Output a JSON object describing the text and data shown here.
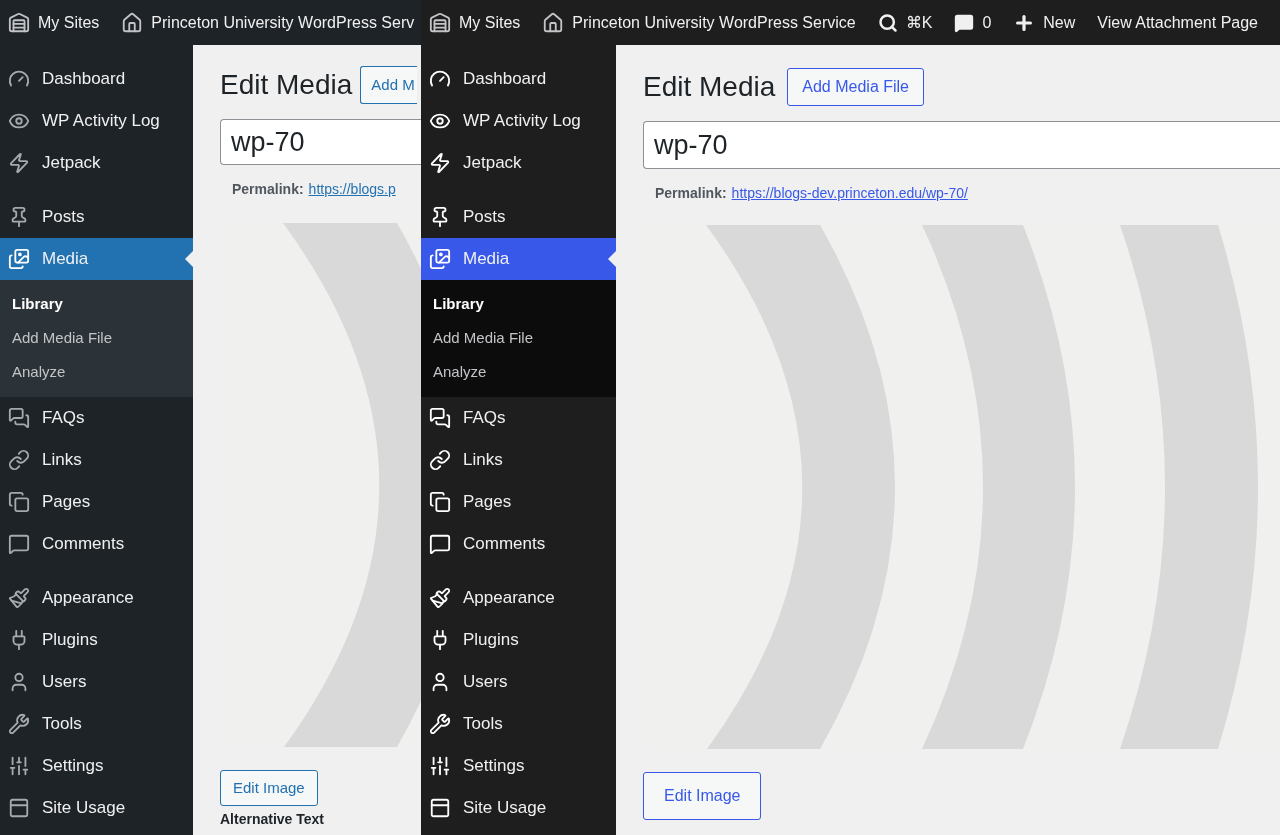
{
  "panels": [
    {
      "kind": "default",
      "admin_bar": [
        {
          "kind": "my-sites",
          "label": "My Sites"
        },
        {
          "kind": "site",
          "label": "Princeton University WordPress Serv"
        }
      ],
      "menu": [
        {
          "items": [
            {
              "label": "Dashboard",
              "selected": false
            },
            {
              "label": "WP Activity Log",
              "selected": false
            },
            {
              "label": "Jetpack",
              "selected": false
            }
          ]
        },
        {
          "items": [
            {
              "label": "Posts",
              "selected": false
            },
            {
              "label": "Media",
              "selected": true,
              "children": [
                {
                  "label": "Library",
                  "selected": true
                },
                {
                  "label": "Add Media File",
                  "selected": false
                },
                {
                  "label": "Analyze",
                  "selected": false
                }
              ]
            },
            {
              "label": "FAQs",
              "selected": false
            },
            {
              "label": "Links",
              "selected": false
            },
            {
              "label": "Pages",
              "selected": false
            },
            {
              "label": "Comments",
              "selected": false
            }
          ]
        },
        {
          "items": [
            {
              "label": "Appearance",
              "selected": false
            },
            {
              "label": "Plugins",
              "selected": false
            },
            {
              "label": "Users",
              "selected": false
            },
            {
              "label": "Tools",
              "selected": false
            },
            {
              "label": "Settings",
              "selected": false
            },
            {
              "label": "Site Usage",
              "selected": false
            }
          ]
        }
      ],
      "title": "Edit Media",
      "add_button": "Add M",
      "title_value": "wp-70",
      "permalink_label": "Permalink:",
      "permalink_url": "https://blogs.p",
      "edit_button": "Edit Image",
      "next_label": "Alternative Text"
    },
    {
      "kind": "modern",
      "admin_bar": [
        {
          "kind": "my-sites",
          "label": "My Sites"
        },
        {
          "kind": "site",
          "label": "Princeton University WordPress Service"
        },
        {
          "kind": "search",
          "label": "⌘K"
        },
        {
          "kind": "comments",
          "label": "0"
        },
        {
          "kind": "new",
          "label": "New"
        },
        {
          "kind": "link",
          "label": "View Attachment Page"
        }
      ],
      "menu": [
        {
          "items": [
            {
              "label": "Dashboard",
              "selected": false
            },
            {
              "label": "WP Activity Log",
              "selected": false
            },
            {
              "label": "Jetpack",
              "selected": false
            }
          ]
        },
        {
          "items": [
            {
              "label": "Posts",
              "selected": false
            },
            {
              "label": "Media",
              "selected": true,
              "children": [
                {
                  "label": "Library",
                  "selected": true
                },
                {
                  "label": "Add Media File",
                  "selected": false
                },
                {
                  "label": "Analyze",
                  "selected": false
                }
              ]
            },
            {
              "label": "FAQs",
              "selected": false
            },
            {
              "label": "Links",
              "selected": false
            },
            {
              "label": "Pages",
              "selected": false
            },
            {
              "label": "Comments",
              "selected": false
            }
          ]
        },
        {
          "items": [
            {
              "label": "Appearance",
              "selected": false
            },
            {
              "label": "Plugins",
              "selected": false
            },
            {
              "label": "Users",
              "selected": false
            },
            {
              "label": "Tools",
              "selected": false
            },
            {
              "label": "Settings",
              "selected": false
            },
            {
              "label": "Site Usage",
              "selected": false
            }
          ]
        }
      ],
      "title": "Edit Media",
      "add_button": "Add Media File",
      "title_value": "wp-70",
      "permalink_label": "Permalink:",
      "permalink_url": "https://blogs-dev.princeton.edu/wp-70/",
      "edit_button": "Edit Image"
    }
  ]
}
